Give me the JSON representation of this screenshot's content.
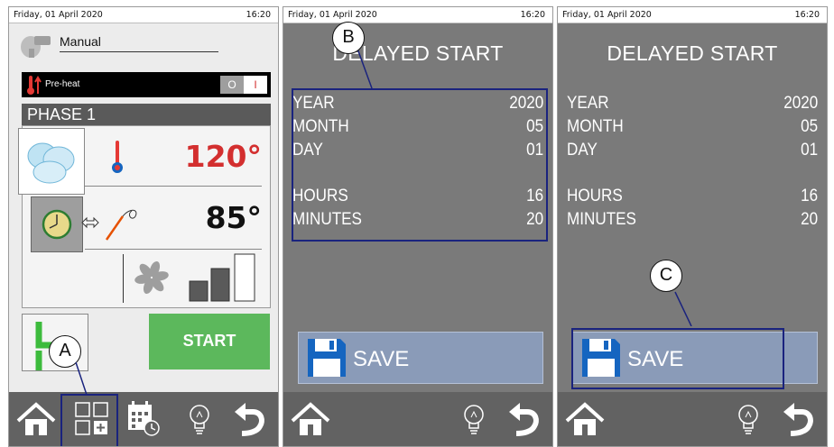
{
  "status_bar": {
    "date": "Friday, 01 April 2020",
    "time": "16:20"
  },
  "panel1": {
    "program_name": "Manual",
    "preheat_label": "Pre-heat",
    "toggle_off": "O",
    "toggle_on": "I",
    "phase_label": "PHASE 1",
    "temperature": "120°",
    "core_temperature": "85°",
    "start_label": "START"
  },
  "delayed_start": {
    "title": "DELAYED START",
    "rows": [
      {
        "label": "YEAR",
        "value": "2020"
      },
      {
        "label": "MONTH",
        "value": "05"
      },
      {
        "label": "DAY",
        "value": "01"
      },
      {
        "label": "HOURS",
        "value": "16"
      },
      {
        "label": "MINUTES",
        "value": "20"
      }
    ],
    "save_label": "SAVE"
  },
  "callouts": {
    "a": "A",
    "b": "B",
    "c": "C"
  },
  "colors": {
    "temp_red": "#d32f2f",
    "start_green": "#5cb85c",
    "save_blue": "#8a9bb8",
    "highlight_navy": "#1a237e",
    "panel_grey": "#7a7a7a",
    "bar_grey": "#626262"
  },
  "icons": [
    "steam-icon",
    "thermometer-icon",
    "probe-icon",
    "clock-icon",
    "fan-icon",
    "home-icon",
    "grid-add-icon",
    "calendar-icon",
    "lightbulb-icon",
    "back-icon",
    "floppy-icon"
  ]
}
